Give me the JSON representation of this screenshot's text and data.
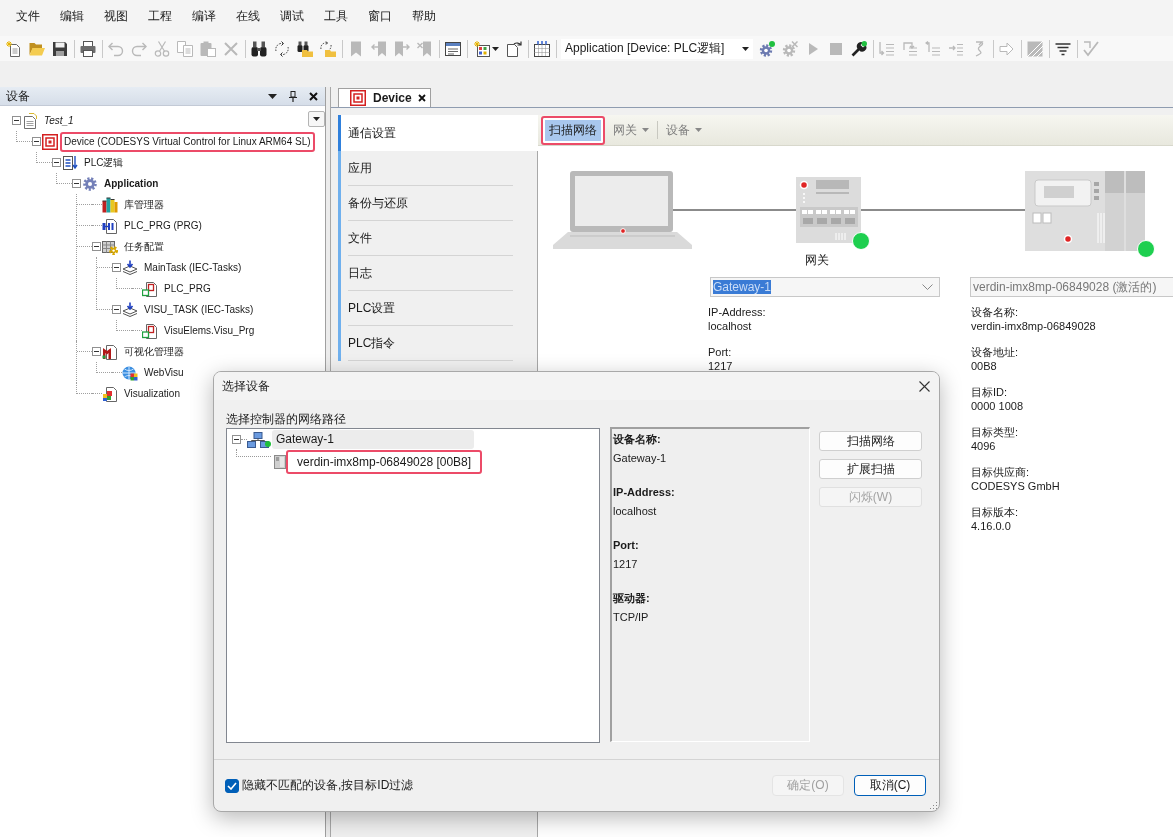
{
  "menu_bar": [
    "文件",
    "编辑",
    "视图",
    "工程",
    "编译",
    "在线",
    "调试",
    "工具",
    "窗口",
    "帮助"
  ],
  "toolbar": [
    {
      "items": [
        {
          "kind": "icon",
          "disabled": false
        },
        {
          "kind": "icon",
          "disabled": false
        },
        {
          "kind": "icon",
          "disabled": false
        }
      ]
    },
    {
      "items": [
        {
          "kind": "icon",
          "disabled": false
        }
      ]
    },
    {
      "items": [
        {
          "kind": "icon",
          "disabled": true
        },
        {
          "kind": "icon",
          "disabled": true
        },
        {
          "kind": "icon",
          "disabled": true
        },
        {
          "kind": "icon",
          "disabled": true
        },
        {
          "kind": "icon",
          "disabled": true
        },
        {
          "kind": "icon",
          "disabled": true
        }
      ]
    },
    {
      "items": [
        {
          "kind": "icon",
          "disabled": false
        },
        {
          "kind": "icon",
          "disabled": false
        },
        {
          "kind": "icon",
          "disabled": false
        },
        {
          "kind": "icon",
          "disabled": false
        }
      ]
    },
    {
      "items": [
        {
          "kind": "icon",
          "disabled": true
        },
        {
          "kind": "icon",
          "disabled": true
        },
        {
          "kind": "icon",
          "disabled": true
        },
        {
          "kind": "icon",
          "disabled": true
        }
      ]
    },
    {
      "items": [
        {
          "kind": "icon",
          "disabled": false
        }
      ]
    },
    {
      "items": [
        {
          "kind": "icon",
          "disabled": false,
          "dropdown": true
        },
        {
          "kind": "icon",
          "disabled": false
        }
      ]
    },
    {
      "items": [
        {
          "kind": "icon",
          "disabled": false
        }
      ]
    },
    {
      "items": [
        {
          "kind": "select",
          "value": "Application [Device: PLC逻辑]"
        },
        {
          "kind": "icon",
          "disabled": false
        },
        {
          "kind": "icon",
          "disabled": true
        },
        {
          "kind": "icon",
          "disabled": true
        },
        {
          "kind": "icon",
          "disabled": true
        },
        {
          "kind": "icon",
          "disabled": false
        }
      ]
    },
    {
      "items": [
        {
          "kind": "icon",
          "disabled": true
        },
        {
          "kind": "icon",
          "disabled": true
        },
        {
          "kind": "icon",
          "disabled": true
        },
        {
          "kind": "icon",
          "disabled": true
        },
        {
          "kind": "icon",
          "disabled": true
        }
      ]
    },
    {
      "items": [
        {
          "kind": "icon",
          "disabled": true
        }
      ]
    },
    {
      "items": [
        {
          "kind": "icon",
          "disabled": true
        }
      ]
    },
    {
      "items": [
        {
          "kind": "icon",
          "disabled": false
        }
      ]
    },
    {
      "items": [
        {
          "kind": "icon",
          "disabled": true
        }
      ]
    }
  ],
  "devices_panel": {
    "title": "设备",
    "tree": [
      {
        "label": "Test_1",
        "kind": "project",
        "expanded": true,
        "highlighted": false,
        "children": [
          {
            "label": "Device (CODESYS Virtual Control for Linux ARM64 SL)",
            "kind": "device",
            "expanded": true,
            "highlighted": true,
            "children": [
              {
                "label": "PLC逻辑",
                "kind": "logic",
                "expanded": true,
                "highlighted": false,
                "children": [
                  {
                    "label": "Application",
                    "kind": "application",
                    "expanded": true,
                    "highlighted": false,
                    "children": [
                      {
                        "label": "库管理器",
                        "kind": "library",
                        "highlighted": false
                      },
                      {
                        "label": "PLC_PRG (PRG)",
                        "kind": "pou",
                        "highlighted": false
                      },
                      {
                        "label": "任务配置",
                        "kind": "task-config",
                        "expanded": true,
                        "highlighted": false,
                        "children": [
                          {
                            "label": "MainTask (IEC-Tasks)",
                            "kind": "task",
                            "expanded": true,
                            "highlighted": false,
                            "children": [
                              {
                                "label": "PLC_PRG",
                                "kind": "call",
                                "highlighted": false
                              }
                            ]
                          },
                          {
                            "label": "VISU_TASK (IEC-Tasks)",
                            "kind": "task",
                            "expanded": true,
                            "highlighted": false,
                            "children": [
                              {
                                "label": "VisuElems.Visu_Prg",
                                "kind": "call",
                                "highlighted": false
                              }
                            ]
                          }
                        ]
                      },
                      {
                        "label": "可视化管理器",
                        "kind": "visu-manager",
                        "expanded": true,
                        "highlighted": false,
                        "children": [
                          {
                            "label": "WebVisu",
                            "kind": "webvisu",
                            "highlighted": false
                          }
                        ]
                      },
                      {
                        "label": "Visualization",
                        "kind": "visualization",
                        "highlighted": false
                      }
                    ]
                  }
                ]
              }
            ]
          }
        ]
      }
    ]
  },
  "editor": {
    "tabs": [
      {
        "label": "Device",
        "selected": true
      }
    ],
    "nav": [
      {
        "label": "通信设置",
        "selected": true
      },
      {
        "label": "应用",
        "selected": false
      },
      {
        "label": "备份与还原",
        "selected": false
      },
      {
        "label": "文件",
        "selected": false
      },
      {
        "label": "日志",
        "selected": false
      },
      {
        "label": "PLC设置",
        "selected": false
      },
      {
        "label": "PLC指令",
        "selected": false
      }
    ],
    "toolbar": [
      {
        "label": "扫描网络",
        "kind": "button",
        "pressed": true,
        "highlighted": true,
        "disabled": false
      },
      {
        "label": "网关",
        "kind": "menu",
        "pressed": false,
        "highlighted": false,
        "disabled": true
      },
      {
        "label": "设备",
        "kind": "menu",
        "pressed": false,
        "highlighted": false,
        "disabled": true
      }
    ],
    "gateway": {
      "label": "网关",
      "connected": true,
      "select": {
        "value": "Gateway-1",
        "focused": true
      },
      "info": [
        {
          "label": "IP-Address:",
          "value": "localhost"
        },
        {
          "label": "Port:",
          "value": "1217"
        }
      ]
    },
    "device": {
      "connected": true,
      "select": {
        "value": "verdin-imx8mp-06849028 (激活的)",
        "focused": false
      },
      "info": [
        {
          "label": "设备名称:",
          "value": "verdin-imx8mp-06849028"
        },
        {
          "label": "设备地址:",
          "value": "00B8"
        },
        {
          "label": "目标ID:",
          "value": "0000 1008"
        },
        {
          "label": "目标类型:",
          "value": "4096"
        },
        {
          "label": "目标供应商:",
          "value": "CODESYS GmbH"
        },
        {
          "label": "目标版本:",
          "value": "4.16.0.0"
        }
      ]
    }
  },
  "dialog": {
    "title": "选择设备",
    "path_label": "选择控制器的网络路径",
    "tree": [
      {
        "label": "Gateway-1",
        "expanded": true,
        "selected": true,
        "highlighted": false,
        "connected": true,
        "children": [
          {
            "label": "verdin-imx8mp-06849028 [00B8]",
            "selected": false,
            "highlighted": true,
            "connected": false
          }
        ]
      }
    ],
    "details": [
      {
        "label": "设备名称:",
        "value": "Gateway-1"
      },
      {
        "label": "IP-Address:",
        "value": "localhost"
      },
      {
        "label": "Port:",
        "value": "1217"
      },
      {
        "label": "驱动器:",
        "value": "TCP/IP"
      }
    ],
    "side_buttons": [
      {
        "label": "扫描网络",
        "disabled": false
      },
      {
        "label": "扩展扫描",
        "disabled": false
      },
      {
        "label": "闪烁(W)",
        "disabled": true
      }
    ],
    "filter_checkbox": {
      "label": "隐藏不匹配的设备,按目标ID过滤",
      "checked": true
    },
    "buttons": [
      {
        "label": "确定(O)",
        "disabled": true,
        "default": false
      },
      {
        "label": "取消(C)",
        "disabled": false,
        "default": true
      }
    ]
  }
}
